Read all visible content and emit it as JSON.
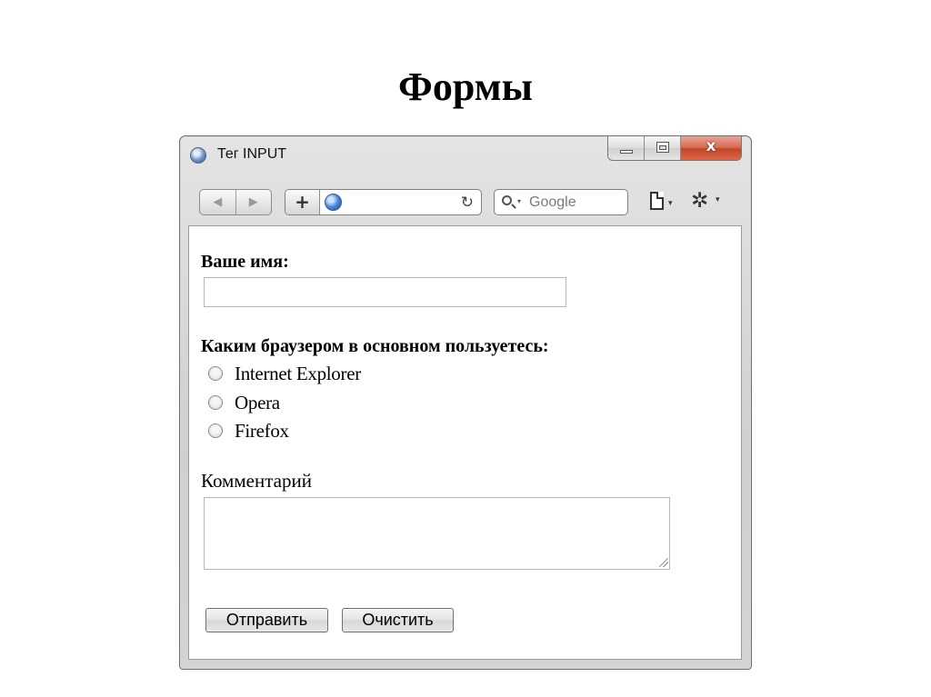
{
  "slide": {
    "title": "Формы"
  },
  "window": {
    "title": "Тег INPUT",
    "minimize_label": "",
    "close_glyph": "x"
  },
  "toolbar": {
    "back_glyph": "◀",
    "forward_glyph": "▶",
    "add_glyph": "+",
    "reload_glyph": "↻",
    "search_placeholder": "Google",
    "dropdown_glyph": "▾",
    "gear_glyph": "✲"
  },
  "form": {
    "name_label": "Ваше имя:",
    "name_value": "",
    "browser_label": "Каким браузером в основном пользуетесь:",
    "browser_options": [
      "Internet Explorer",
      "Opera",
      "Firefox"
    ],
    "comment_label": "Комментарий",
    "comment_value": "",
    "submit_label": "Отправить",
    "reset_label": "Очистить"
  },
  "icons": {
    "app": "safari-compass-icon",
    "globe": "globe-icon",
    "search": "search-icon",
    "page": "page-icon",
    "gear": "gear-icon"
  },
  "colors": {
    "close_button": "#c64528",
    "window_frame": "#d4d4d4"
  }
}
